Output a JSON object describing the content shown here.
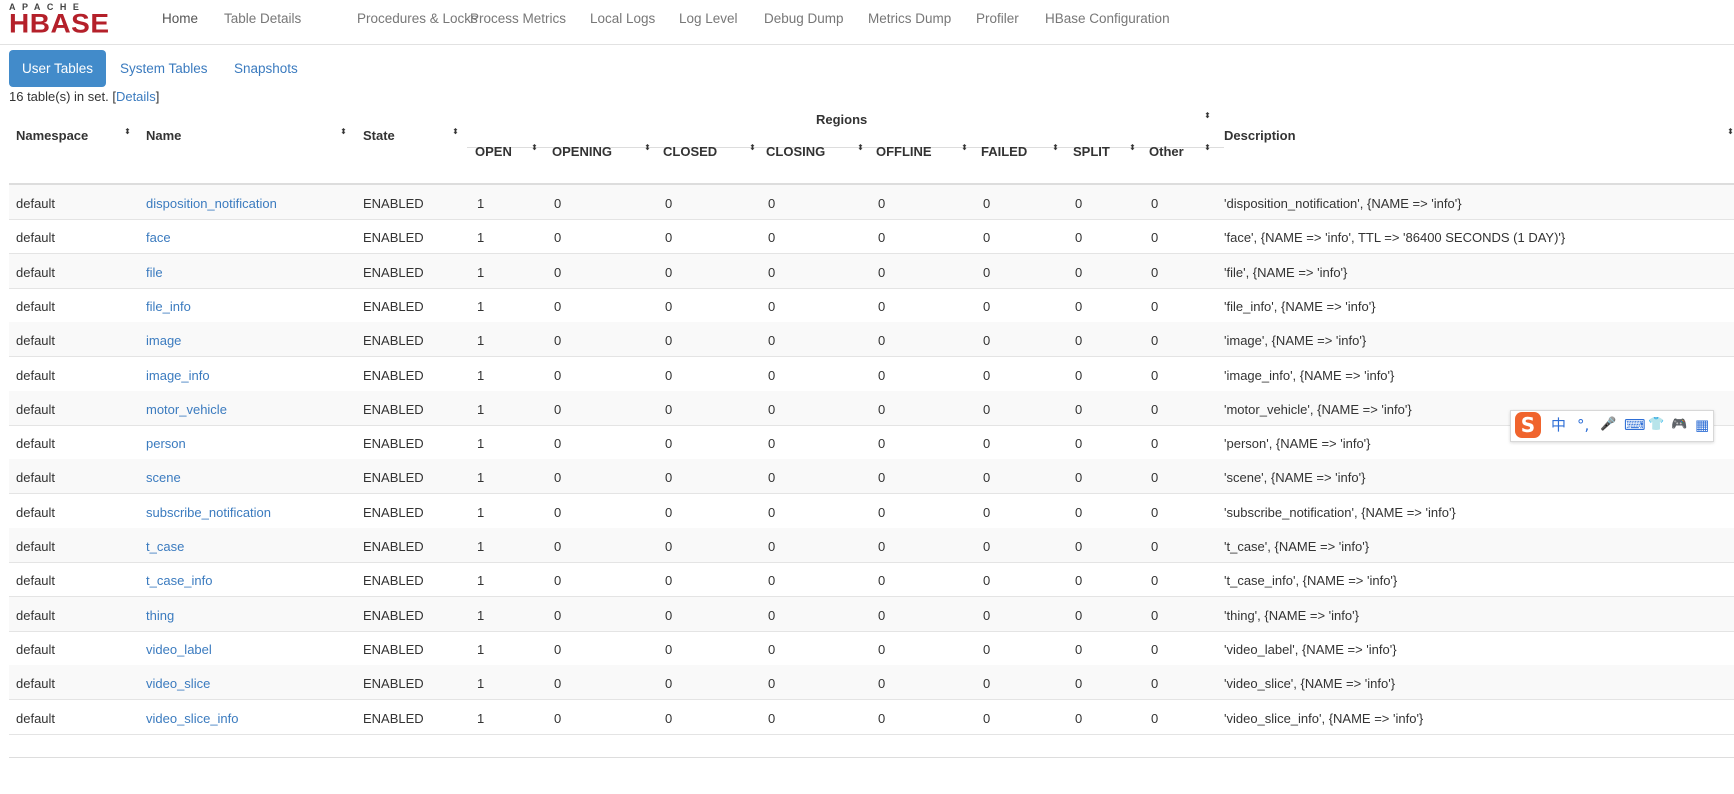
{
  "logo": {
    "top": "APACHE",
    "main": "HBASE"
  },
  "nav": [
    "Home",
    "Table Details",
    "Procedures & Locks",
    "Process Metrics",
    "Local Logs",
    "Log Level",
    "Debug Dump",
    "Metrics Dump",
    "Profiler",
    "HBase Configuration"
  ],
  "tabs": [
    "User Tables",
    "System Tables",
    "Snapshots"
  ],
  "summary": {
    "prefix": "16 table(s) in set. [",
    "link": "Details",
    "suffix": "]"
  },
  "table": {
    "group_header": "Regions",
    "headers": {
      "namespace": "Namespace",
      "name": "Name",
      "state": "State",
      "open": "OPEN",
      "opening": "OPENING",
      "closed": "CLOSED",
      "closing": "CLOSING",
      "offline": "OFFLINE",
      "failed": "FAILED",
      "split": "SPLIT",
      "other": "Other",
      "description": "Description"
    },
    "sort_glyph": "⬍",
    "rows": [
      {
        "namespace": "default",
        "name": "disposition_notification",
        "state": "ENABLED",
        "open": "1",
        "opening": "0",
        "closed": "0",
        "closing": "0",
        "offline": "0",
        "failed": "0",
        "split": "0",
        "other": "0",
        "description": "'disposition_notification', {NAME => 'info'}"
      },
      {
        "namespace": "default",
        "name": "face",
        "state": "ENABLED",
        "open": "1",
        "opening": "0",
        "closed": "0",
        "closing": "0",
        "offline": "0",
        "failed": "0",
        "split": "0",
        "other": "0",
        "description": "'face', {NAME => 'info', TTL => '86400 SECONDS (1 DAY)'}"
      },
      {
        "namespace": "default",
        "name": "file",
        "state": "ENABLED",
        "open": "1",
        "opening": "0",
        "closed": "0",
        "closing": "0",
        "offline": "0",
        "failed": "0",
        "split": "0",
        "other": "0",
        "description": "'file', {NAME => 'info'}"
      },
      {
        "namespace": "default",
        "name": "file_info",
        "state": "ENABLED",
        "open": "1",
        "opening": "0",
        "closed": "0",
        "closing": "0",
        "offline": "0",
        "failed": "0",
        "split": "0",
        "other": "0",
        "description": "'file_info', {NAME => 'info'}"
      },
      {
        "namespace": "default",
        "name": "image",
        "state": "ENABLED",
        "open": "1",
        "opening": "0",
        "closed": "0",
        "closing": "0",
        "offline": "0",
        "failed": "0",
        "split": "0",
        "other": "0",
        "description": "'image', {NAME => 'info'}"
      },
      {
        "namespace": "default",
        "name": "image_info",
        "state": "ENABLED",
        "open": "1",
        "opening": "0",
        "closed": "0",
        "closing": "0",
        "offline": "0",
        "failed": "0",
        "split": "0",
        "other": "0",
        "description": "'image_info', {NAME => 'info'}"
      },
      {
        "namespace": "default",
        "name": "motor_vehicle",
        "state": "ENABLED",
        "open": "1",
        "opening": "0",
        "closed": "0",
        "closing": "0",
        "offline": "0",
        "failed": "0",
        "split": "0",
        "other": "0",
        "description": "'motor_vehicle', {NAME => 'info'}"
      },
      {
        "namespace": "default",
        "name": "person",
        "state": "ENABLED",
        "open": "1",
        "opening": "0",
        "closed": "0",
        "closing": "0",
        "offline": "0",
        "failed": "0",
        "split": "0",
        "other": "0",
        "description": "'person', {NAME => 'info'}"
      },
      {
        "namespace": "default",
        "name": "scene",
        "state": "ENABLED",
        "open": "1",
        "opening": "0",
        "closed": "0",
        "closing": "0",
        "offline": "0",
        "failed": "0",
        "split": "0",
        "other": "0",
        "description": "'scene', {NAME => 'info'}"
      },
      {
        "namespace": "default",
        "name": "subscribe_notification",
        "state": "ENABLED",
        "open": "1",
        "opening": "0",
        "closed": "0",
        "closing": "0",
        "offline": "0",
        "failed": "0",
        "split": "0",
        "other": "0",
        "description": "'subscribe_notification', {NAME => 'info'}"
      },
      {
        "namespace": "default",
        "name": "t_case",
        "state": "ENABLED",
        "open": "1",
        "opening": "0",
        "closed": "0",
        "closing": "0",
        "offline": "0",
        "failed": "0",
        "split": "0",
        "other": "0",
        "description": "'t_case', {NAME => 'info'}"
      },
      {
        "namespace": "default",
        "name": "t_case_info",
        "state": "ENABLED",
        "open": "1",
        "opening": "0",
        "closed": "0",
        "closing": "0",
        "offline": "0",
        "failed": "0",
        "split": "0",
        "other": "0",
        "description": "'t_case_info', {NAME => 'info'}"
      },
      {
        "namespace": "default",
        "name": "thing",
        "state": "ENABLED",
        "open": "1",
        "opening": "0",
        "closed": "0",
        "closing": "0",
        "offline": "0",
        "failed": "0",
        "split": "0",
        "other": "0",
        "description": "'thing', {NAME => 'info'}"
      },
      {
        "namespace": "default",
        "name": "video_label",
        "state": "ENABLED",
        "open": "1",
        "opening": "0",
        "closed": "0",
        "closing": "0",
        "offline": "0",
        "failed": "0",
        "split": "0",
        "other": "0",
        "description": "'video_label', {NAME => 'info'}"
      },
      {
        "namespace": "default",
        "name": "video_slice",
        "state": "ENABLED",
        "open": "1",
        "opening": "0",
        "closed": "0",
        "closing": "0",
        "offline": "0",
        "failed": "0",
        "split": "0",
        "other": "0",
        "description": "'video_slice', {NAME => 'info'}"
      },
      {
        "namespace": "default",
        "name": "video_slice_info",
        "state": "ENABLED",
        "open": "1",
        "opening": "0",
        "closed": "0",
        "closing": "0",
        "offline": "0",
        "failed": "0",
        "split": "0",
        "other": "0",
        "description": "'video_slice_info', {NAME => 'info'}"
      }
    ]
  },
  "ime_toolbar": {
    "logo": "S",
    "items": [
      {
        "icon": "chinese-mode-icon",
        "glyph": "中"
      },
      {
        "icon": "punctuation-icon",
        "glyph": "°,"
      },
      {
        "icon": "microphone-icon",
        "glyph": "🎤"
      },
      {
        "icon": "keyboard-icon",
        "glyph": "⌨"
      },
      {
        "icon": "skin-icon",
        "glyph": "👕"
      },
      {
        "icon": "game-icon",
        "glyph": "🎮"
      },
      {
        "icon": "toolbox-icon",
        "glyph": "▦"
      }
    ]
  },
  "colors": {
    "link": "#3b7bbf",
    "active_tab": "#428bca",
    "logo_red": "#b4202a",
    "ime_orange": "#f0642d"
  }
}
